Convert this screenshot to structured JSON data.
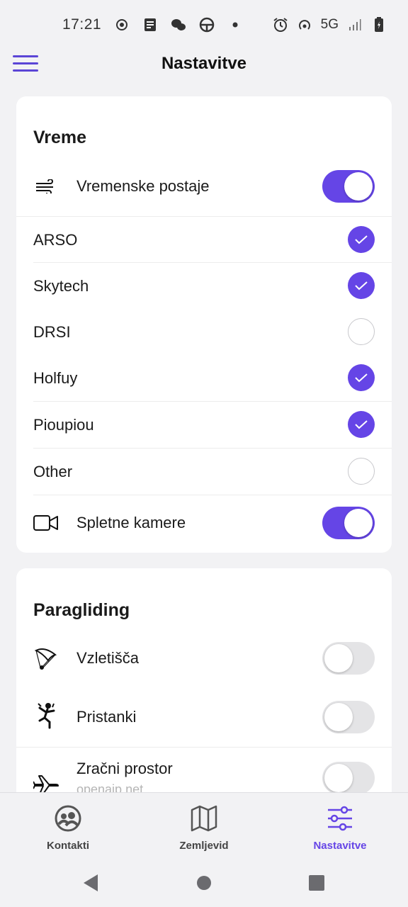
{
  "status_bar": {
    "time": "17:21",
    "network": "5G",
    "icons_left": [
      "record-icon",
      "note-icon",
      "chat-icon",
      "steering-icon",
      "dot-icon"
    ],
    "icons_right": [
      "alarm-icon",
      "hotspot-icon",
      "signal-icon",
      "battery-icon"
    ]
  },
  "header": {
    "title": "Nastavitve",
    "accent": "#6545e6"
  },
  "weather": {
    "title": "Vreme",
    "stations": {
      "label": "Vremenske postaje",
      "icon": "wind-icon",
      "enabled": true
    },
    "sources": [
      {
        "label": "ARSO",
        "checked": true
      },
      {
        "label": "Skytech",
        "checked": true
      },
      {
        "label": "DRSI",
        "checked": false
      },
      {
        "label": "Holfuy",
        "checked": true
      },
      {
        "label": "Pioupiou",
        "checked": true
      },
      {
        "label": "Other",
        "checked": false
      }
    ],
    "webcams": {
      "label": "Spletne kamere",
      "icon": "video-camera-icon",
      "enabled": true
    }
  },
  "paragliding": {
    "title": "Paragliding",
    "items": [
      {
        "label": "Vzletišča",
        "icon": "paraglider-icon",
        "enabled": false
      },
      {
        "label": "Pristanki",
        "icon": "landing-person-icon",
        "enabled": false
      },
      {
        "label": "Zračni prostor",
        "sublabel": "openaip.net",
        "icon": "airplane-icon",
        "enabled": false
      }
    ]
  },
  "bottom_nav": {
    "items": [
      {
        "label": "Kontakti",
        "icon": "contacts-icon",
        "active": false
      },
      {
        "label": "Zemljevid",
        "icon": "map-icon",
        "active": false
      },
      {
        "label": "Nastavitve",
        "icon": "sliders-icon",
        "active": true
      }
    ]
  },
  "system_nav": [
    "back-icon",
    "home-icon",
    "recents-icon"
  ]
}
